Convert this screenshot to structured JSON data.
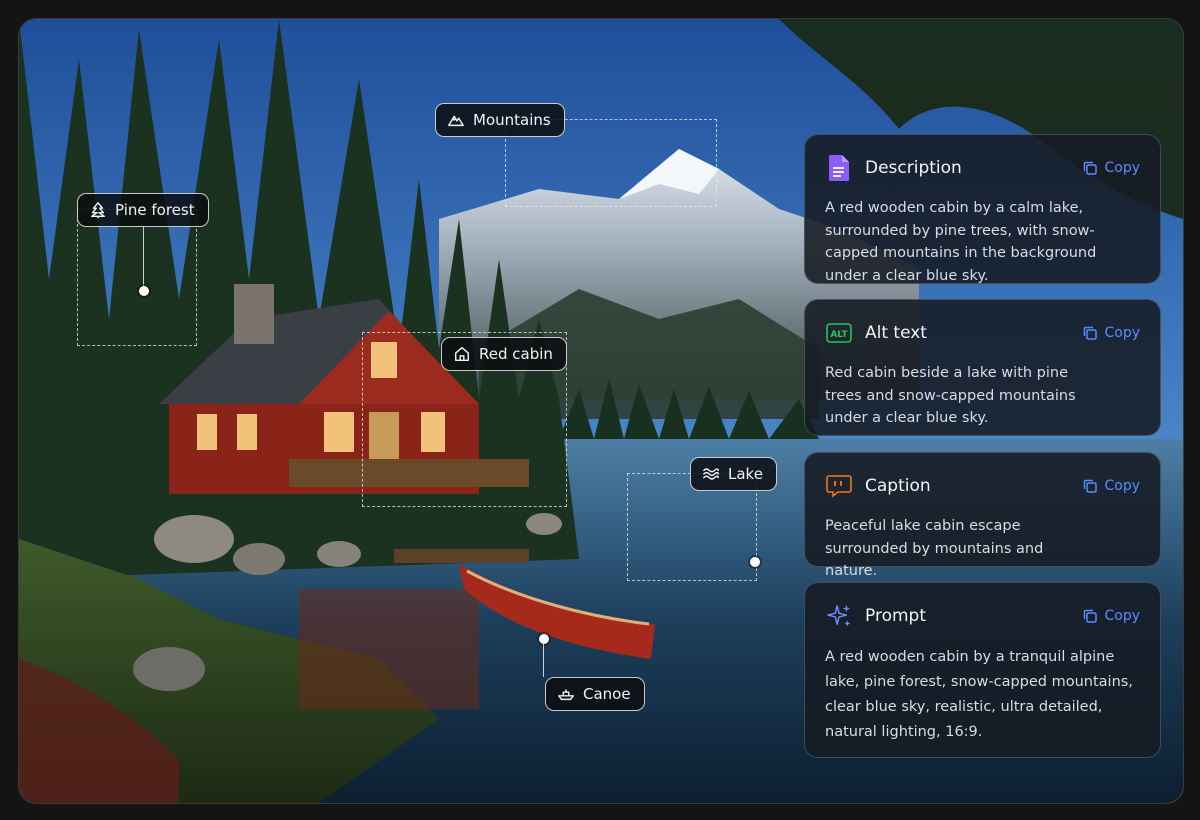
{
  "tags": {
    "mountains": "Mountains",
    "pine_forest": "Pine forest",
    "red_cabin": "Red cabin",
    "lake": "Lake",
    "canoe": "Canoe"
  },
  "cards": {
    "description": {
      "title": "Description",
      "copy": "Copy",
      "text": "A red wooden cabin by a calm lake, surrounded by pine trees, with snow-capped mountains in the background under a clear blue sky.",
      "icon": "document-icon",
      "color": "#8b5cf6"
    },
    "alt_text": {
      "title": "Alt text",
      "copy": "Copy",
      "badge": "ALT",
      "text": "Red cabin beside a lake with pine trees and snow-capped mountains under a clear blue sky.",
      "icon": "alt-badge-icon",
      "color": "#22c55e"
    },
    "caption": {
      "title": "Caption",
      "copy": "Copy",
      "text": "Peaceful lake cabin escape surrounded by mountains and nature.",
      "icon": "quote-bubble-icon",
      "color": "#f97316"
    },
    "prompt": {
      "title": "Prompt",
      "copy": "Copy",
      "text": "A red wooden cabin by a tranquil alpine lake, pine forest, snow-capped mountains, clear blue sky, realistic, ultra detailed, natural lighting, 16:9.",
      "icon": "sparkles-icon",
      "color": "#6d8cff"
    }
  },
  "accent_color": "#5a8cff"
}
